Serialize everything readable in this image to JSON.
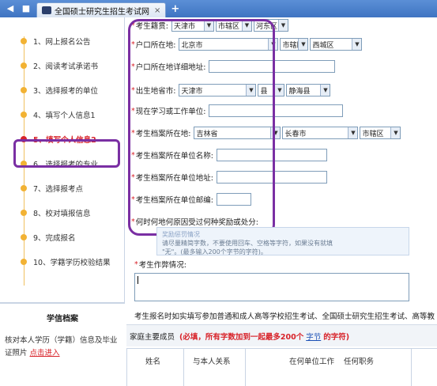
{
  "browser": {
    "tab_title": "全国硕士研究生招生考试网",
    "close_glyph": "×",
    "new_tab_glyph": "+"
  },
  "sidebar": {
    "steps": [
      {
        "label": "1、网上报名公告",
        "active": false
      },
      {
        "label": "2、阅读考试承诺书",
        "active": false
      },
      {
        "label": "3、选择报考的单位",
        "active": false
      },
      {
        "label": "4、填写个人信息1",
        "active": false
      },
      {
        "label": "5、填写个人信息2",
        "active": true
      },
      {
        "label": "6、选择报考的专业",
        "active": false
      },
      {
        "label": "7、选择报考点",
        "active": false
      },
      {
        "label": "8、校对填报信息",
        "active": false
      },
      {
        "label": "9、完成报名",
        "active": false
      },
      {
        "label": "10、学籍学历校验结果",
        "active": false
      }
    ],
    "info": {
      "title": "学信档案",
      "text": "核对本人学历（学籍）信息及毕业证照片",
      "link": "点击进入"
    }
  },
  "form": {
    "rows": [
      {
        "label": "考生籍贯:",
        "selects": [
          "天津市",
          "市辖区",
          "河东区"
        ]
      },
      {
        "label": "户口所在地:",
        "selects": [
          "北京市",
          "市辖区",
          "西城区"
        ]
      },
      {
        "label": "户口所在地详细地址:",
        "input": ""
      },
      {
        "label": "出生地省市:",
        "selects": [
          "天津市",
          "县",
          "静海县"
        ]
      },
      {
        "label": "现在学习或工作单位:",
        "input": ""
      },
      {
        "label": "考生档案所在地:",
        "selects": [
          "吉林省",
          "长春市",
          "市辖区"
        ]
      },
      {
        "label": "考生档案所在单位名称:",
        "input": ""
      },
      {
        "label": "考生档案所在单位地址:",
        "input": ""
      },
      {
        "label": "考生档案所在单位邮编:",
        "input": ""
      },
      {
        "label": "何时何地何原因受过何种奖励或处分:"
      }
    ],
    "hint": {
      "line1": "奖励惩罚情况",
      "line2": "请尽量精简字数，不要使用回车、空格等字符，如果没有就填",
      "line3": "\"无\"。(最多输入200个字节的字符)。"
    },
    "cheating_label": "考生作弊情况:",
    "notice": "考生报名时如实填写参加普通和成人高等学校招生考试、全国硕士研究生招生考试、高等教",
    "family": {
      "title": "家庭主要成员",
      "warning_pre": "(必填，所有字数加到一起最多200个",
      "add_link": "字节",
      "warning_post": "的字符)"
    },
    "table_headers": [
      "姓名",
      "与本人关系",
      "在何单位工作",
      "任何职务"
    ]
  },
  "colors": {
    "accent": "#d8232a",
    "highlight_ring": "#7a2fa3",
    "step_dot": "#f2b233"
  }
}
